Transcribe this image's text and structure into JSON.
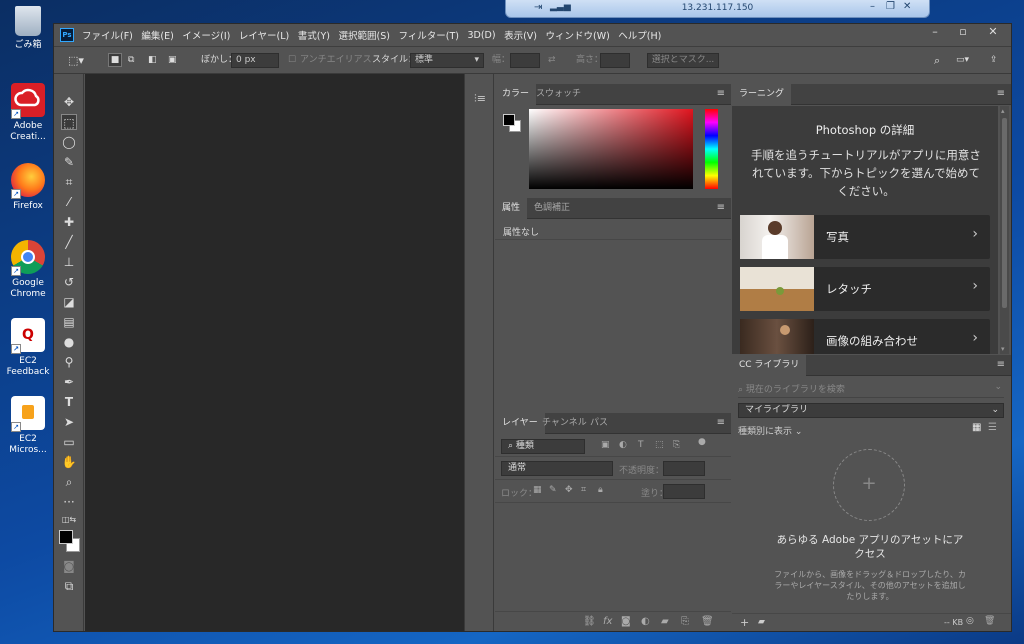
{
  "desktop": {
    "icons": [
      {
        "label": "ごみ箱"
      },
      {
        "label": "Adobe Creati..."
      },
      {
        "label": "Firefox"
      },
      {
        "label": "Google Chrome"
      },
      {
        "label": "EC2 Feedback"
      },
      {
        "label": "EC2 Micros..."
      }
    ]
  },
  "rdp": {
    "title": "13.231.117.150"
  },
  "app": {
    "logo": "Ps",
    "menus": [
      "ファイル(F)",
      "編集(E)",
      "イメージ(I)",
      "レイヤー(L)",
      "書式(Y)",
      "選択範囲(S)",
      "フィルター(T)",
      "3D(D)",
      "表示(V)",
      "ウィンドウ(W)",
      "ヘルプ(H)"
    ]
  },
  "options": {
    "feather_label": "ぼかし：",
    "feather_value": "0 px",
    "antialias": "アンチエイリアス",
    "style_label": "スタイル：",
    "style_value": "標準",
    "width_label": "幅：",
    "height_label": "高さ：",
    "select_mask": "選択とマスク..."
  },
  "color_panel": {
    "tabs": [
      "カラー",
      "スウォッチ"
    ],
    "hue_color": "#e0141e"
  },
  "properties_panel": {
    "tabs": [
      "属性",
      "色調補正"
    ],
    "text": "属性なし"
  },
  "layers_panel": {
    "tabs": [
      "レイヤー",
      "チャンネル",
      "パス"
    ],
    "filter_label": "種類",
    "blend_mode": "通常",
    "opacity_label": "不透明度：",
    "lock_label": "ロック：",
    "fill_label": "塗り："
  },
  "learning_panel": {
    "tab": "ラーニング",
    "title": "Photoshop の詳細",
    "description": "手順を追うチュートリアルがアプリに用意されています。下からトピックを選んで始めてください。",
    "cards": [
      {
        "label": "写真"
      },
      {
        "label": "レタッチ"
      },
      {
        "label": "画像の組み合わせ"
      }
    ]
  },
  "library_panel": {
    "tab": "CC ライブラリ",
    "search_placeholder": "現在のライブラリを検索",
    "library_name": "マイライブラリ",
    "view_label": "種類別に表示",
    "empty_title": "あらゆる Adobe アプリのアセットにアクセス",
    "empty_desc": "ファイルから、画像をドラッグ＆ドロップしたり、カラーやレイヤースタイル、その他のアセットを追加したりします。",
    "size_label": "-- KB"
  }
}
